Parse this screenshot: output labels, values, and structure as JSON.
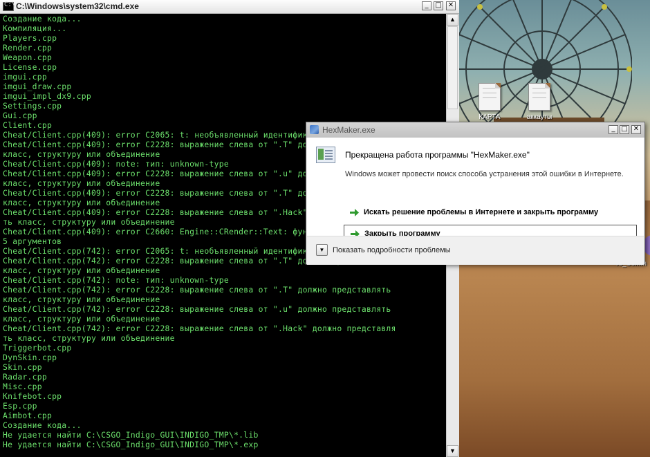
{
  "console": {
    "title": "C:\\Windows\\system32\\cmd.exe",
    "lines": [
      "Создание кода...",
      "Компиляция...",
      "Players.cpp",
      "Render.cpp",
      "Weapon.cpp",
      "License.cpp",
      "imgui.cpp",
      "imgui_draw.cpp",
      "imgui_impl_dx9.cpp",
      "Settings.cpp",
      "Gui.cpp",
      "Client.cpp",
      "Cheat/Client.cpp(409): error C2065: t: необъявленный идентификатор",
      "Cheat/Client.cpp(409): error C2228: выражение слева от \".T\" должно представлять",
      "класс, структуру или объединение",
      "Cheat/Client.cpp(409): note: тип: unknown-type",
      "Cheat/Client.cpp(409): error C2228: выражение слева от \".u\" должно представлять",
      "класс, структуру или объединение",
      "Cheat/Client.cpp(409): error C2228: выражение слева от \".T\" должно представлять",
      "класс, структуру или объединение",
      "Cheat/Client.cpp(409): error C2228: выражение слева от \".Hack\" должно представля",
      "ть класс, структуру или объединение",
      "Cheat/Client.cpp(409): error C2660: Engine::CRender::Text: функция не принимает",
      "5 аргументов",
      "Cheat/Client.cpp(742): error C2065: t: необъявленный идентификатор",
      "Cheat/Client.cpp(742): error C2228: выражение слева от \".T\" должно представлять",
      "класс, структуру или объединение",
      "Cheat/Client.cpp(742): note: тип: unknown-type",
      "Cheat/Client.cpp(742): error C2228: выражение слева от \".T\" должно представлять",
      "класс, структуру или объединение",
      "Cheat/Client.cpp(742): error C2228: выражение слева от \".u\" должно представлять",
      "класс, структуру или объединение",
      "Cheat/Client.cpp(742): error C2228: выражение слева от \".Hack\" должно представля",
      "ть класс, структуру или объединение",
      "Triggerbot.cpp",
      "DynSkin.cpp",
      "Skin.cpp",
      "Radar.cpp",
      "Misc.cpp",
      "Knifebot.cpp",
      "Esp.cpp",
      "Aimbot.cpp",
      "Создание кода...",
      "Не удается найти C:\\CSGO_Indigo_GUI\\INDIGO_TMP\\*.lib",
      "Не удается найти C:\\CSGO_Indigo_GUI\\INDIGO_TMP\\*.exp"
    ],
    "text_color": "#6ce06c",
    "background": "#000000"
  },
  "desktop": {
    "icons": [
      {
        "label": "КАРТА"
      },
      {
        "label": "аккауты"
      }
    ],
    "partial_label": "vs_Comm"
  },
  "dialog": {
    "title": "HexMaker.exe",
    "heading": "Прекращена работа программы \"HexMaker.exe\"",
    "info": "Windows может провести поиск способа устранения этой ошибки в Интернете.",
    "option_search": "Искать решение проблемы в Интернете и закрыть программу",
    "option_close": "Закрыть программу",
    "details": "Показать подробности проблемы",
    "arrow_color": "#2f9a2f"
  }
}
